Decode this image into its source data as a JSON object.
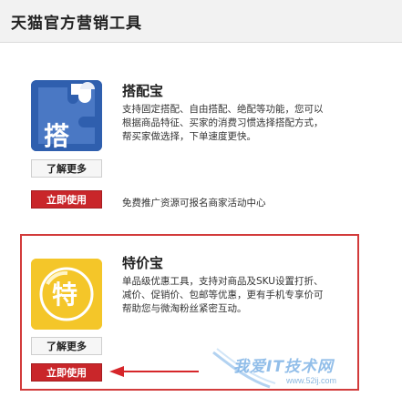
{
  "header": {
    "title": "天猫官方营销工具"
  },
  "tools": [
    {
      "name": "搭配宝",
      "icon_glyph": "搭",
      "icon": "puzzle-icon",
      "desc_lines": [
        "支持固定搭配、自由搭配、绝配等功能，您可以",
        "根据商品特征、买家的消费习惯选择搭配方式，",
        "帮买家做选择，下单速度更快。"
      ],
      "learn_label": "了解更多",
      "use_label": "立即使用",
      "promo_text": "免费推广资源可报名商家活动中心"
    },
    {
      "name": "特价宝",
      "icon_glyph": "特",
      "icon": "price-tag-icon",
      "desc_lines": [
        "单品级优惠工具，支持对商品及SKU设置打折、",
        "减价、促销价、包邮等优惠，更有手机专享价可",
        "帮助您与微淘粉丝紧密互动。"
      ],
      "learn_label": "了解更多",
      "use_label": "立即使用"
    }
  ],
  "watermark": {
    "text": "我爱IT技术网",
    "url": "www.52ij.com"
  },
  "colors": {
    "accent_red": "#c9262a",
    "highlight_border": "#d23b3b",
    "icon_blue": "#2f5fae",
    "icon_yellow": "#f4c629"
  }
}
